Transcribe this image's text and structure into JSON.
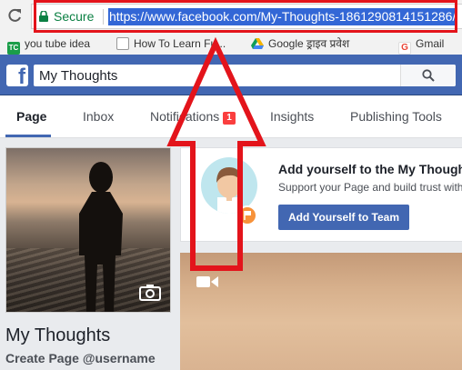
{
  "browser": {
    "secure_label": "Secure",
    "url": "https://www.facebook.com/My-Thoughts-1861290814151286/"
  },
  "bookmarks": [
    {
      "label": "you tube idea",
      "icon": "tc-icon",
      "color": "#1a9d49"
    },
    {
      "label": "How To Learn Fu...",
      "icon": "page-icon",
      "color": "#ffffff"
    },
    {
      "label": "Google ड्राइव प्रवेश",
      "icon": "drive-icon",
      "color": "#f4b400"
    },
    {
      "label": "Gmail",
      "icon": "google-icon",
      "color": "#ea4335"
    }
  ],
  "facebook": {
    "logo": "f",
    "search_value": "My Thoughts",
    "brand_color": "#4267b2"
  },
  "tabs": {
    "page": "Page",
    "inbox": "Inbox",
    "notifications": "Notifications",
    "notifications_count": "1",
    "insights": "Insights",
    "publishing_tools": "Publishing Tools"
  },
  "profile": {
    "name": "My Thoughts",
    "username_link": "Create Page @username"
  },
  "card": {
    "title": "Add yourself to the My Thoughts Page",
    "subtitle": "Support your Page and build trust with",
    "button": "Add Yourself to Team"
  },
  "annotation_color": "#e3141b"
}
